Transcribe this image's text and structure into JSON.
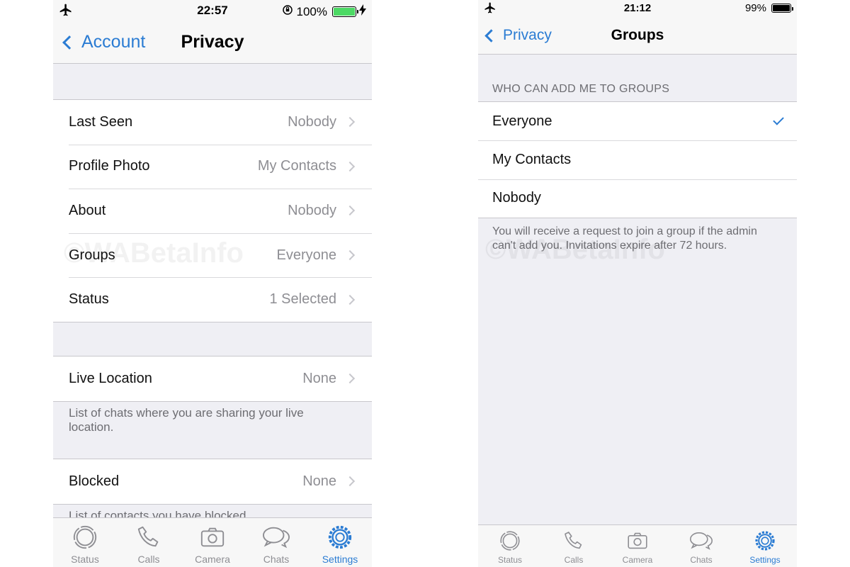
{
  "left": {
    "status": {
      "time": "22:57",
      "battery_text": "100%",
      "battery_color": "#4cd964",
      "battery_level": 1.0
    },
    "nav": {
      "back_label": "Account",
      "title": "Privacy"
    },
    "rows": [
      {
        "label": "Last Seen",
        "value": "Nobody"
      },
      {
        "label": "Profile Photo",
        "value": "My Contacts"
      },
      {
        "label": "About",
        "value": "Nobody"
      },
      {
        "label": "Groups",
        "value": "Everyone"
      },
      {
        "label": "Status",
        "value": "1 Selected"
      }
    ],
    "live_location": {
      "label": "Live Location",
      "value": "None",
      "footnote": "List of chats where you are sharing your live location."
    },
    "blocked": {
      "label": "Blocked",
      "value": "None",
      "footnote": "List of contacts you have blocked."
    },
    "watermark": "©WABetaInfo",
    "tabs": [
      {
        "label": "Status",
        "icon": "status-icon",
        "active": false
      },
      {
        "label": "Calls",
        "icon": "phone-icon",
        "active": false
      },
      {
        "label": "Camera",
        "icon": "camera-icon",
        "active": false
      },
      {
        "label": "Chats",
        "icon": "chat-bubbles-icon",
        "active": false
      },
      {
        "label": "Settings",
        "icon": "gear-icon",
        "active": true
      }
    ]
  },
  "right": {
    "status": {
      "time": "21:12",
      "battery_text": "99%",
      "battery_color": "#000000",
      "battery_level": 0.99
    },
    "nav": {
      "back_label": "Privacy",
      "title": "Groups"
    },
    "section_header": "WHO CAN ADD ME TO GROUPS",
    "options": [
      {
        "label": "Everyone",
        "selected": true
      },
      {
        "label": "My Contacts",
        "selected": false
      },
      {
        "label": "Nobody",
        "selected": false
      }
    ],
    "footnote": "You will receive a request to join a group if the admin can't add you. Invitations expire after 72 hours.",
    "watermark": "©WABetaInfo",
    "tabs": [
      {
        "label": "Status",
        "icon": "status-icon",
        "active": false
      },
      {
        "label": "Calls",
        "icon": "phone-icon",
        "active": false
      },
      {
        "label": "Camera",
        "icon": "camera-icon",
        "active": false
      },
      {
        "label": "Chats",
        "icon": "chat-bubbles-icon",
        "active": false
      },
      {
        "label": "Settings",
        "icon": "gear-icon",
        "active": true
      }
    ]
  },
  "colors": {
    "accent": "#2b7cd3",
    "background": "#efeff4",
    "separator": "#c8c7cc",
    "secondary_text": "#8e8e93"
  }
}
